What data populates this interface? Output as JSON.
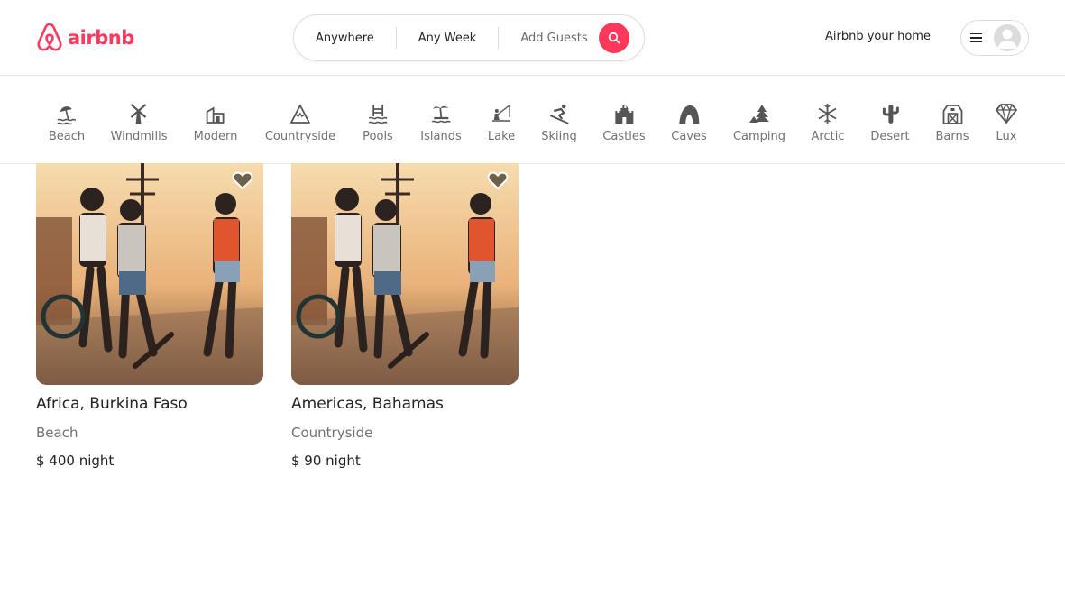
{
  "brand": {
    "name": "airbnb",
    "color": "#ff385c"
  },
  "search": {
    "where": "Anywhere",
    "when": "Any Week",
    "guests": "Add Guests",
    "icon": "search-icon"
  },
  "header": {
    "host_link": "Airbnb your home",
    "menu_icon": "menu-icon",
    "avatar_icon": "user-avatar-icon"
  },
  "categories": [
    {
      "label": "Beach",
      "icon": "beach-icon"
    },
    {
      "label": "Windmills",
      "icon": "windmill-icon"
    },
    {
      "label": "Modern",
      "icon": "modern-house-icon"
    },
    {
      "label": "Countryside",
      "icon": "mountain-icon"
    },
    {
      "label": "Pools",
      "icon": "pool-icon"
    },
    {
      "label": "Islands",
      "icon": "island-icon"
    },
    {
      "label": "Lake",
      "icon": "lake-icon"
    },
    {
      "label": "Skiing",
      "icon": "skiing-icon"
    },
    {
      "label": "Castles",
      "icon": "castle-icon"
    },
    {
      "label": "Caves",
      "icon": "cave-icon"
    },
    {
      "label": "Camping",
      "icon": "camping-icon"
    },
    {
      "label": "Arctic",
      "icon": "snowflake-icon"
    },
    {
      "label": "Desert",
      "icon": "cactus-icon"
    },
    {
      "label": "Barns",
      "icon": "barn-icon"
    },
    {
      "label": "Lux",
      "icon": "diamond-icon"
    }
  ],
  "listings": [
    {
      "title": "Africa, Burkina Faso",
      "category": "Beach",
      "price": "$ 400 night"
    },
    {
      "title": "Americas, Bahamas",
      "category": "Countryside",
      "price": "$ 90 night"
    }
  ]
}
